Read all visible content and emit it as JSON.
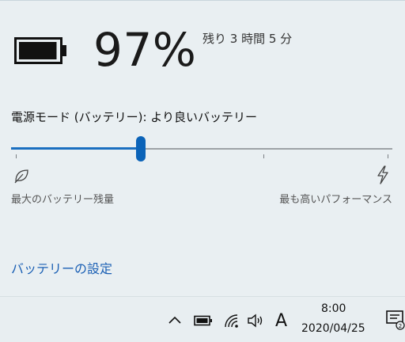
{
  "battery": {
    "percent_text": "97%",
    "level": 0.97,
    "remaining_text": "残り 3 時間 5 分"
  },
  "power_mode": {
    "label": "電源モード (バッテリー): より良いバッテリー",
    "slider_value": 0.34,
    "left_end_label": "最大のバッテリー残量",
    "right_end_label": "最も高いパフォーマンス",
    "left_icon": "leaf-icon",
    "right_icon": "lightning-icon"
  },
  "links": {
    "battery_settings": "バッテリーの設定"
  },
  "taskbar": {
    "icons": [
      "chevron-up-icon",
      "battery-icon",
      "wifi-icon",
      "speaker-icon",
      "notification-icon"
    ],
    "ime_mode": "A",
    "time": "8:00",
    "date": "2020/04/25"
  },
  "colors": {
    "accent": "#0b63b8",
    "link": "#1a5fb4",
    "flyout_bg": "#e9eff2"
  }
}
